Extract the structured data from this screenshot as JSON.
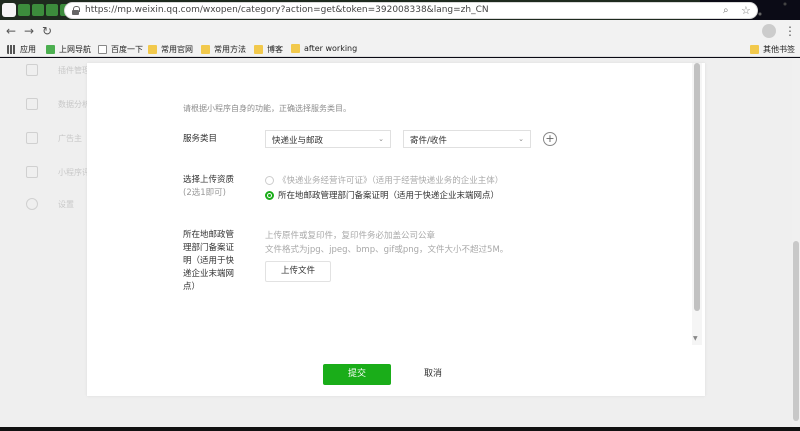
{
  "browser": {
    "tab_colors": [
      "#4a4a4a",
      "#3c8c3c",
      "#3c8c3c",
      "#3c8c3c",
      "#3c8c3c",
      "#3c8c3c",
      "#3c8c3c",
      "#3c8c3c",
      "#3c8c3c",
      "#3c8c3c",
      "#3c8c3c",
      "#c03030",
      "#3c8c3c",
      "#c03030",
      "#c03030",
      "#c03030",
      "#5a7ab0",
      "#3c8c3c",
      "#888888",
      "#4a8ad0",
      "#3c8c3c",
      "#4a8ad0",
      "#4a8ad0",
      "#4a8ad0",
      "#4a8ad0",
      "#8ab040",
      "#888888",
      "#4a8ad0",
      "#4a8ad0",
      "#d0b030",
      "#d0b030",
      "#4a8ad0",
      "#4a8ad0",
      "#4a8ad0",
      "#3c8c3c",
      "#444444",
      "#c03030",
      "#3c8c3c",
      "#3c8c3c",
      "#3c8c3c",
      "#3c8c3c"
    ],
    "url": "https://mp.weixin.qq.com/wxopen/category?action=get&token=392008338&lang=zh_CN",
    "new_tab_label": "+",
    "menu_label": "⋮"
  },
  "bookmarks": {
    "apps": "应用",
    "items": [
      "上网导航",
      "百度一下",
      "常用官网",
      "常用方法",
      "博客",
      "after working"
    ],
    "other": "其他书签"
  },
  "sidebar": {
    "items": [
      "插件管理",
      "数据分析",
      "广告主",
      "小程序评测",
      "设置"
    ]
  },
  "form": {
    "hint": "请根据小程序自身的功能，正确选择服务类目。",
    "service_category": {
      "label": "服务类目",
      "primary": "快递业与邮政",
      "secondary": "寄件/收件",
      "add": "+"
    },
    "qualification": {
      "label": "选择上传资质",
      "sublabel": "(2选1即可)",
      "options": [
        {
          "text": "《快递业务经营许可证》（适用于经营快递业务的企业主体）",
          "selected": false
        },
        {
          "text": "所在地邮政管理部门备案证明（适用于快递企业末端网点）",
          "selected": true
        }
      ]
    },
    "upload": {
      "label_lines": [
        "所在地邮政管",
        "理部门备案证",
        "明（适用于快",
        "递企业末端网",
        "点）"
      ],
      "hint1": "上传原件或复印件，复印件务必加盖公司公章",
      "hint2": "文件格式为jpg、jpeg、bmp、gif或png，文件大小不超过5M。",
      "button": "上传文件"
    },
    "actions": {
      "submit": "提交",
      "cancel": "取消"
    }
  },
  "colors": {
    "accent_green": "#1aad19"
  }
}
